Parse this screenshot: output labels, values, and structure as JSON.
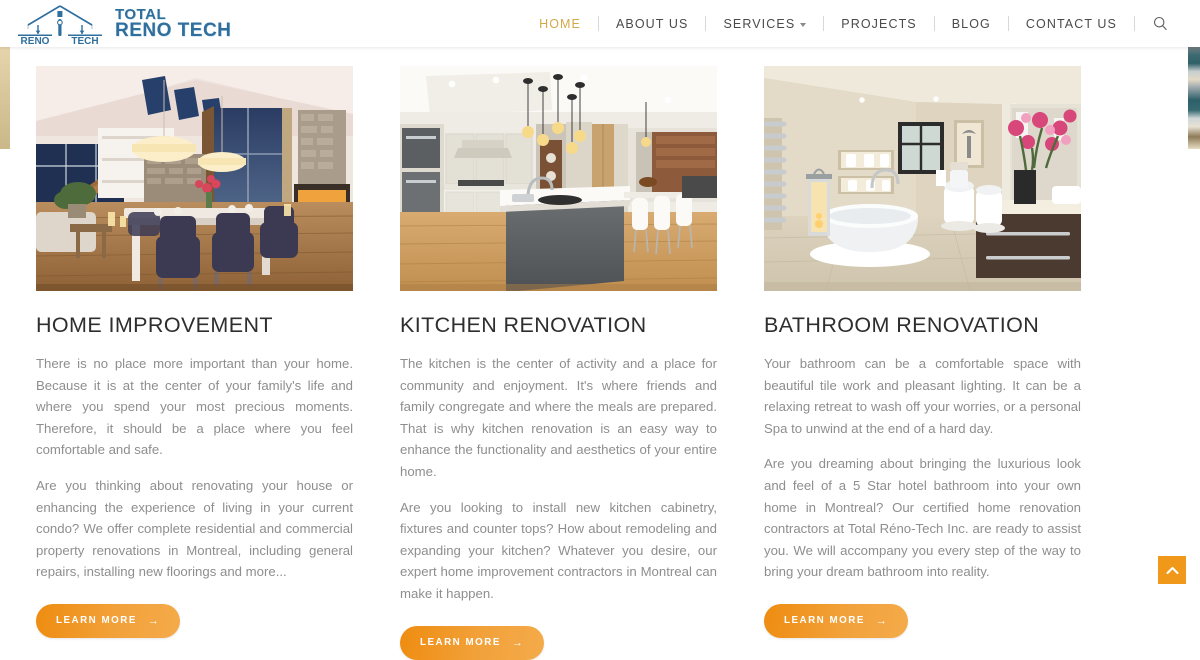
{
  "header": {
    "logo": {
      "icon": "house-logo-icon",
      "badge_left": "RENO",
      "badge_right": "TECH",
      "wordmark_line1": "TOTAL",
      "wordmark_line2": "RENO TECH",
      "wordmark_color": "#2f6f9e"
    },
    "nav": {
      "active_color": "#d4a84b",
      "items": [
        {
          "label": "HOME",
          "active": true,
          "has_dropdown": false
        },
        {
          "label": "ABOUT US",
          "active": false,
          "has_dropdown": false
        },
        {
          "label": "SERVICES",
          "active": false,
          "has_dropdown": true
        },
        {
          "label": "PROJECTS",
          "active": false,
          "has_dropdown": false
        },
        {
          "label": "BLOG",
          "active": false,
          "has_dropdown": false
        },
        {
          "label": "CONTACT US",
          "active": false,
          "has_dropdown": false
        }
      ],
      "search_icon": "search-icon"
    }
  },
  "columns": [
    {
      "image_alt": "modern dining room with vaulted ceiling, pendant lamps and stone fireplace",
      "title": "HOME IMPROVEMENT",
      "paragraph1": "There is no place more important than your home. Because it is at the center of your family's life and where you spend your most precious moments. Therefore, it should be a place where you feel comfortable and safe.",
      "paragraph2": "Are you thinking about renovating your house or enhancing the experience of living in your current condo? We offer complete residential and commercial property renovations in Montreal, including general repairs, installing new floorings and more...",
      "button_label": "LEARN MORE",
      "button_arrow": "→"
    },
    {
      "image_alt": "bright white kitchen with grey island, pendant lights and wood floor",
      "title": "KITCHEN RENOVATION",
      "paragraph1": "The kitchen is the center of activity and a place for community and enjoyment. It's where friends and family congregate and where the meals are prepared. That is why kitchen renovation is an easy way to enhance the functionality and aesthetics of your entire home.",
      "paragraph2": "Are you looking to install new kitchen cabinetry, fixtures and counter tops? How about remodeling and expanding your kitchen? Whatever you desire, our expert home improvement contractors in Montreal can make it happen.",
      "button_label": "LEARN MORE",
      "button_arrow": "→"
    },
    {
      "image_alt": "cream marble bathroom with freestanding oval tub, dark vanity and pink flowers",
      "title": "BATHROOM RENOVATION",
      "paragraph1": "Your bathroom can be a comfortable space with beautiful tile work and pleasant lighting. It can be a relaxing retreat to wash off your worries, or a personal Spa to unwind at the end of a hard day.",
      "paragraph2": "Are you dreaming about bringing the luxurious look and feel of a 5 Star hotel bathroom into your own home in Montreal? Our certified home renovation contractors at Total Réno-Tech Inc. are ready to assist you. We will accompany you every step of the way to bring your dream bathroom into reality.",
      "button_label": "LEARN MORE",
      "button_arrow": "→"
    }
  ],
  "scroll_top": {
    "icon": "chevron-up-icon",
    "color": "#f09819"
  },
  "theme": {
    "accent_orange": "#f09819",
    "accent_gold": "#d4a84b",
    "body_text": "#8e8e8e",
    "heading_text": "#2e2e2e"
  }
}
